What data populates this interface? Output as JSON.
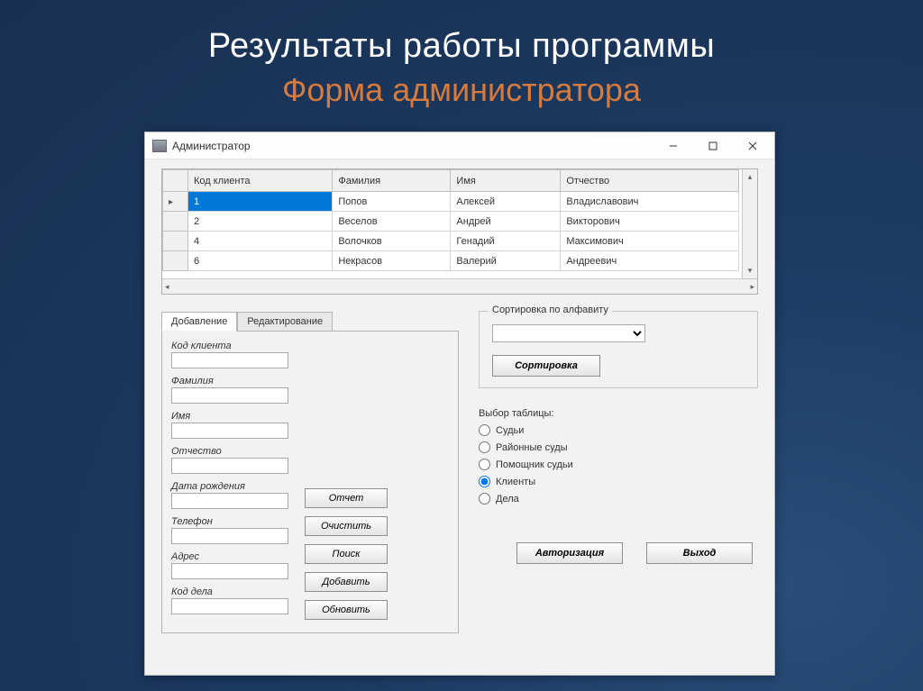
{
  "slide": {
    "title": "Результаты работы программы",
    "subtitle": "Форма администратора"
  },
  "window": {
    "title": "Администратор"
  },
  "grid": {
    "columns": [
      "Код клиента",
      "Фамилия",
      "Имя",
      "Отчество"
    ],
    "rows": [
      {
        "id": "1",
        "lastname": "Попов",
        "firstname": "Алексей",
        "patronymic": "Владиславович"
      },
      {
        "id": "2",
        "lastname": "Веселов",
        "firstname": "Андрей",
        "patronymic": "Викторович"
      },
      {
        "id": "4",
        "lastname": "Волочков",
        "firstname": "Генадий",
        "patronymic": "Максимович"
      },
      {
        "id": "6",
        "lastname": "Некрасов",
        "firstname": "Валерий",
        "patronymic": "Андреевич"
      }
    ]
  },
  "tabs": {
    "add": "Добавление",
    "edit": "Редактирование"
  },
  "form": {
    "client_code": "Код клиента",
    "lastname": "Фамилия",
    "firstname": "Имя",
    "patronymic": "Отчество",
    "birthdate": "Дата рождения",
    "phone": "Телефон",
    "address": "Адрес",
    "case_code": "Код дела"
  },
  "buttons": {
    "report": "Отчет",
    "clear": "Очистить",
    "search": "Поиск",
    "add": "Добавить",
    "update": "Обновить",
    "sort": "Сортировка",
    "auth": "Авторизация",
    "exit": "Выход"
  },
  "sortbox": {
    "legend": "Сортировка по алфавиту"
  },
  "tablepick": {
    "label": "Выбор таблицы:",
    "options": [
      "Судьи",
      "Районные суды",
      "Помощник судьи",
      "Клиенты",
      "Дела"
    ],
    "selected": "Клиенты"
  }
}
